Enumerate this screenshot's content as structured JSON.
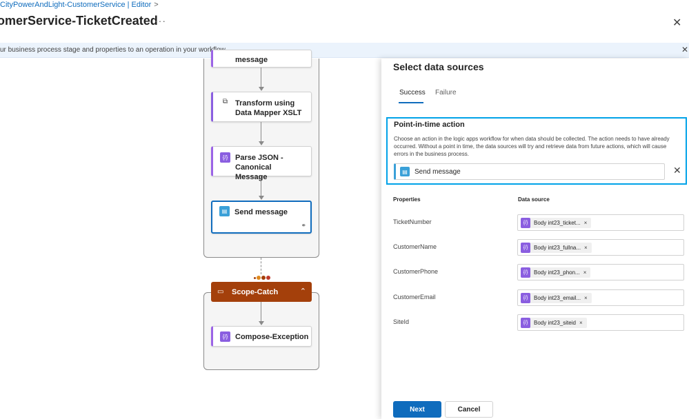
{
  "header": {
    "breadcrumb": "CityPowerAndLight-CustomerService | Editor",
    "breadcrumb_sep": ">",
    "title": "omerService-TicketCreated",
    "more": "···",
    "close": "✕"
  },
  "info_bar": {
    "text": "ur business process stage and properties to an operation in your workflow.",
    "close": "✕"
  },
  "workflow": {
    "cards": [
      {
        "label": "message",
        "icon": "message-icon"
      },
      {
        "label": "Transform using Data Mapper XSLT",
        "icon": "transform-icon",
        "icon_glyph": "⧉"
      },
      {
        "label": "Parse JSON - Canonical Message",
        "icon": "parse-json-icon",
        "icon_glyph": "{/}"
      },
      {
        "label": "Send message",
        "icon": "send-message-icon",
        "icon_glyph": "▤",
        "link_glyph": "⚭"
      }
    ],
    "scope_catch": {
      "label": "Scope-Catch",
      "icon_glyph": "▭",
      "chevron": "⌃"
    },
    "compose": {
      "label": "Compose-Exception",
      "icon_glyph": "{/}"
    },
    "dot_colors": [
      "#a4400b",
      "#e08a1e",
      "#a4400b",
      "#c0392b"
    ]
  },
  "panel": {
    "title": "Select data sources",
    "tabs": [
      {
        "label": "Success",
        "active": true
      },
      {
        "label": "Failure",
        "active": false
      }
    ],
    "point_in_time": {
      "title": "Point-in-time action",
      "description": "Choose an action in the logic apps workflow for when data should be collected. The action needs to have already occurred. Without a point in time, the data sources will try and retrieve data from future actions, which will cause errors in the business process.",
      "action_label": "Send message",
      "action_icon_glyph": "▤",
      "remove": "✕"
    },
    "columns": {
      "properties": "Properties",
      "data_source": "Data source"
    },
    "rows": [
      {
        "property": "TicketNumber",
        "token": "Body int23_ticket...",
        "remove": "×"
      },
      {
        "property": "CustomerName",
        "token": "Body int23_fullna...",
        "remove": "×"
      },
      {
        "property": "CustomerPhone",
        "token": "Body int23_phon...",
        "remove": "×"
      },
      {
        "property": "CustomerEmail",
        "token": "Body int23_email...",
        "remove": "×"
      },
      {
        "property": "SiteId",
        "token": "Body int23_siteid",
        "remove": "×"
      }
    ],
    "token_icon_glyph": "{/}",
    "buttons": {
      "next": "Next",
      "cancel": "Cancel"
    }
  },
  "colors": {
    "accent": "#0f6cbd",
    "highlight_border": "#00a2e8",
    "scope_catch": "#a4400b",
    "action_purple": "#8a5ee0",
    "action_teal": "#3aa0d8"
  }
}
